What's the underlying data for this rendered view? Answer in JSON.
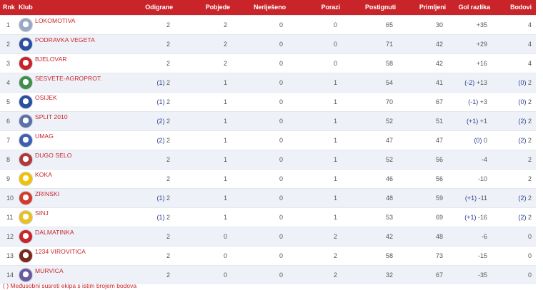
{
  "table": {
    "headers": {
      "rnk": "Rnk",
      "klub": "Klub",
      "odigrane": "Odigrane",
      "pobjede": "Pobjede",
      "nerijeseno": "Neriješeno",
      "porazi": "Porazi",
      "postignuti": "Postignuti",
      "primljeni": "Primljeni",
      "gol_razlika": "Gol razlika",
      "bodovi": "Bodovi"
    },
    "rows": [
      {
        "rnk": "1",
        "club": "LOKOMOTIVA",
        "odigrane_mini": "",
        "odigrane": "2",
        "pobjede": "2",
        "nerijeseno": "0",
        "porazi": "0",
        "postignuti": "65",
        "primljeni": "30",
        "gol_mini": "",
        "gol_razlika": "+35",
        "bodovi_mini": "",
        "bodovi": "4",
        "crest_color": "#9aa8c4"
      },
      {
        "rnk": "2",
        "club": "PODRAVKA VEGETA",
        "odigrane_mini": "",
        "odigrane": "2",
        "pobjede": "2",
        "nerijeseno": "0",
        "porazi": "0",
        "postignuti": "71",
        "primljeni": "42",
        "gol_mini": "",
        "gol_razlika": "+29",
        "bodovi_mini": "",
        "bodovi": "4",
        "crest_color": "#2a4fa0"
      },
      {
        "rnk": "3",
        "club": "BJELOVAR",
        "odigrane_mini": "",
        "odigrane": "2",
        "pobjede": "2",
        "nerijeseno": "0",
        "porazi": "0",
        "postignuti": "58",
        "primljeni": "42",
        "gol_mini": "",
        "gol_razlika": "+16",
        "bodovi_mini": "",
        "bodovi": "4",
        "crest_color": "#c8242a"
      },
      {
        "rnk": "4",
        "club": "SESVETE-AGROPROT.",
        "odigrane_mini": "(1)",
        "odigrane": "2",
        "pobjede": "1",
        "nerijeseno": "0",
        "porazi": "1",
        "postignuti": "54",
        "primljeni": "41",
        "gol_mini": "(-2)",
        "gol_razlika": "+13",
        "bodovi_mini": "(0)",
        "bodovi": "2",
        "crest_color": "#3f8f4a"
      },
      {
        "rnk": "5",
        "club": "OSIJEK",
        "odigrane_mini": "(1)",
        "odigrane": "2",
        "pobjede": "1",
        "nerijeseno": "0",
        "porazi": "1",
        "postignuti": "70",
        "primljeni": "67",
        "gol_mini": "(-1)",
        "gol_razlika": "+3",
        "bodovi_mini": "(0)",
        "bodovi": "2",
        "crest_color": "#2a4fa0"
      },
      {
        "rnk": "6",
        "club": "SPLIT 2010",
        "odigrane_mini": "(2)",
        "odigrane": "2",
        "pobjede": "1",
        "nerijeseno": "0",
        "porazi": "1",
        "postignuti": "52",
        "primljeni": "51",
        "gol_mini": "(+1)",
        "gol_razlika": "+1",
        "bodovi_mini": "(2)",
        "bodovi": "2",
        "crest_color": "#5d6fa8"
      },
      {
        "rnk": "7",
        "club": "UMAG",
        "odigrane_mini": "(2)",
        "odigrane": "2",
        "pobjede": "1",
        "nerijeseno": "0",
        "porazi": "1",
        "postignuti": "47",
        "primljeni": "47",
        "gol_mini": "(0)",
        "gol_razlika": "0",
        "bodovi_mini": "(2)",
        "bodovi": "2",
        "crest_color": "#3d5fb0"
      },
      {
        "rnk": "8",
        "club": "DUGO SELO",
        "odigrane_mini": "",
        "odigrane": "2",
        "pobjede": "1",
        "nerijeseno": "0",
        "porazi": "1",
        "postignuti": "52",
        "primljeni": "56",
        "gol_mini": "",
        "gol_razlika": "-4",
        "bodovi_mini": "",
        "bodovi": "2",
        "crest_color": "#b03a3a"
      },
      {
        "rnk": "9",
        "club": "KOKA",
        "odigrane_mini": "",
        "odigrane": "2",
        "pobjede": "1",
        "nerijeseno": "0",
        "porazi": "1",
        "postignuti": "46",
        "primljeni": "56",
        "gol_mini": "",
        "gol_razlika": "-10",
        "bodovi_mini": "",
        "bodovi": "2",
        "crest_color": "#f2c200"
      },
      {
        "rnk": "10",
        "club": "ZRINSKI",
        "odigrane_mini": "(1)",
        "odigrane": "2",
        "pobjede": "1",
        "nerijeseno": "0",
        "porazi": "1",
        "postignuti": "48",
        "primljeni": "59",
        "gol_mini": "(+1)",
        "gol_razlika": "-11",
        "bodovi_mini": "(2)",
        "bodovi": "2",
        "crest_color": "#d43a2a"
      },
      {
        "rnk": "11",
        "club": "SINJ",
        "odigrane_mini": "(1)",
        "odigrane": "2",
        "pobjede": "1",
        "nerijeseno": "0",
        "porazi": "1",
        "postignuti": "53",
        "primljeni": "69",
        "gol_mini": "(+1)",
        "gol_razlika": "-16",
        "bodovi_mini": "(2)",
        "bodovi": "2",
        "crest_color": "#e8c020"
      },
      {
        "rnk": "12",
        "club": "DALMATINKA",
        "odigrane_mini": "",
        "odigrane": "2",
        "pobjede": "0",
        "nerijeseno": "0",
        "porazi": "2",
        "postignuti": "42",
        "primljeni": "48",
        "gol_mini": "",
        "gol_razlika": "-6",
        "bodovi_mini": "",
        "bodovi": "0",
        "crest_color": "#c8242a"
      },
      {
        "rnk": "13",
        "club": "1234 VIROVITICA",
        "odigrane_mini": "",
        "odigrane": "2",
        "pobjede": "0",
        "nerijeseno": "0",
        "porazi": "2",
        "postignuti": "58",
        "primljeni": "73",
        "gol_mini": "",
        "gol_razlika": "-15",
        "bodovi_mini": "",
        "bodovi": "0",
        "crest_color": "#7a2a1a"
      },
      {
        "rnk": "14",
        "club": "MURVICA",
        "odigrane_mini": "",
        "odigrane": "2",
        "pobjede": "0",
        "nerijeseno": "0",
        "porazi": "2",
        "postignuti": "32",
        "primljeni": "67",
        "gol_mini": "",
        "gol_razlika": "-35",
        "bodovi_mini": "",
        "bodovi": "0",
        "crest_color": "#6a5aa0"
      }
    ]
  },
  "footer": {
    "note": "( ) Međusobni susreti ekipa s istim brojem bodova"
  },
  "colors": {
    "header_bg": "#c8242a",
    "club_link": "#c8242a",
    "mini_table": "#2b3d8f",
    "row_alt": "#eef2f8"
  }
}
